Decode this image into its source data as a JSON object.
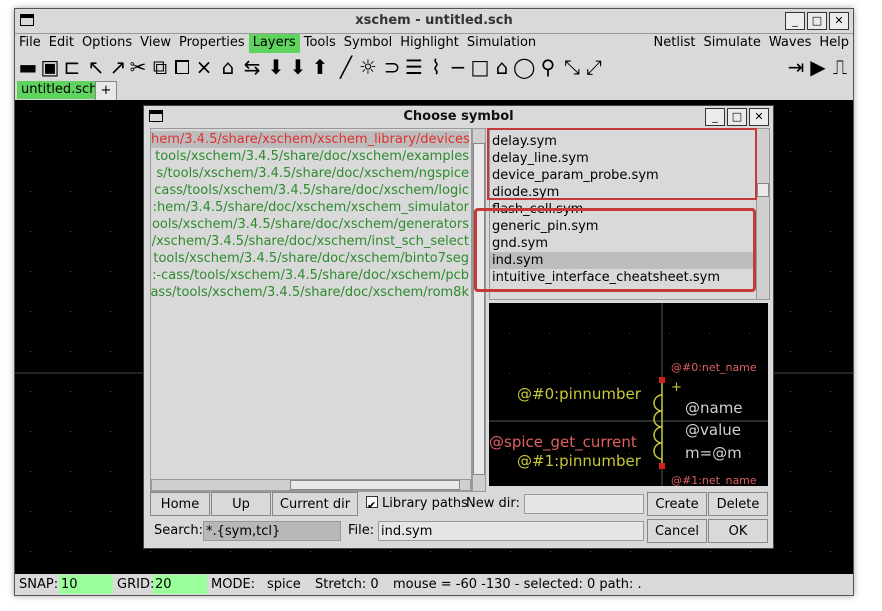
{
  "window": {
    "title": "xschem - untitled.sch"
  },
  "menubar": {
    "left": [
      "File",
      "Edit",
      "Options",
      "View",
      "Properties",
      "Layers",
      "Tools",
      "Symbol",
      "Highlight",
      "Simulation"
    ],
    "right": [
      "Netlist",
      "Simulate",
      "Waves",
      "Help"
    ],
    "highlighted": "Layers"
  },
  "toolbar": {
    "icons": [
      "open-folder",
      "save",
      "new-window",
      "undo",
      "redo",
      "cut",
      "copy",
      "paste",
      "delete",
      "insert-symbol",
      "move",
      "push-down",
      "pull-up",
      "go-up",
      "wire",
      "line",
      "polygon",
      "arc",
      "search",
      "zoom-in",
      "zoom-out",
      "netlist",
      "simulate",
      "waves"
    ]
  },
  "tabs": {
    "active": "untitled.sch",
    "add": "+"
  },
  "status": {
    "snap_label": "SNAP:",
    "snap": "10",
    "grid_label": "GRID:",
    "grid": "20",
    "mode_label": "MODE:",
    "mode": "spice",
    "stretch": "Stretch: 0",
    "mouse": "mouse = -60 -130 - selected: 0 path: ."
  },
  "dialog": {
    "title": "Choose symbol",
    "paths": [
      "hem/3.4.5/share/xschem/xschem_library/devices",
      "tools/xschem/3.4.5/share/doc/xschem/examples",
      "s/tools/xschem/3.4.5/share/doc/xschem/ngspice",
      "cass/tools/xschem/3.4.5/share/doc/xschem/logic",
      ":hem/3.4.5/share/doc/xschem/xschem_simulator",
      "ools/xschem/3.4.5/share/doc/xschem/generators",
      "/xschem/3.4.5/share/doc/xschem/inst_sch_select",
      "tools/xschem/3.4.5/share/doc/xschem/binto7seg",
      ":-cass/tools/xschem/3.4.5/share/doc/xschem/pcb",
      "ass/tools/xschem/3.4.5/share/doc/xschem/rom8k"
    ],
    "files": [
      "delay.sym",
      "delay_line.sym",
      "device_param_probe.sym",
      "diode.sym",
      "flash_cell.sym",
      "generic_pin.sym",
      "gnd.sym",
      "ind.sym",
      "intuitive_interface_cheatsheet.sym"
    ],
    "selected_file": "ind.sym",
    "preview": {
      "net0": "@#0:net_name",
      "pin0": "@#0:pinnumber",
      "name": "@name",
      "value": "@value",
      "m": "m=@m",
      "spice": "@spice_get_current",
      "pin1": "@#1:pinnumber",
      "net1": "@#1:net_name",
      "plus": "+"
    },
    "buttons": {
      "home": "Home",
      "up": "Up",
      "current_dir": "Current dir",
      "library_paths": "Library paths",
      "new_dir_label": "New dir:",
      "create": "Create",
      "delete": "Delete",
      "search_label": "Search:",
      "search_value": "*.{sym,tcl}",
      "file_label": "File:",
      "file_value": "ind.sym",
      "cancel": "Cancel",
      "ok": "OK"
    }
  },
  "colors": {
    "accent_green": "#5ed45e",
    "path_green": "#2e8b2e",
    "highlight_red": "#c43a3a",
    "preview_yellow": "#c8c83a",
    "preview_red": "#e06060"
  }
}
